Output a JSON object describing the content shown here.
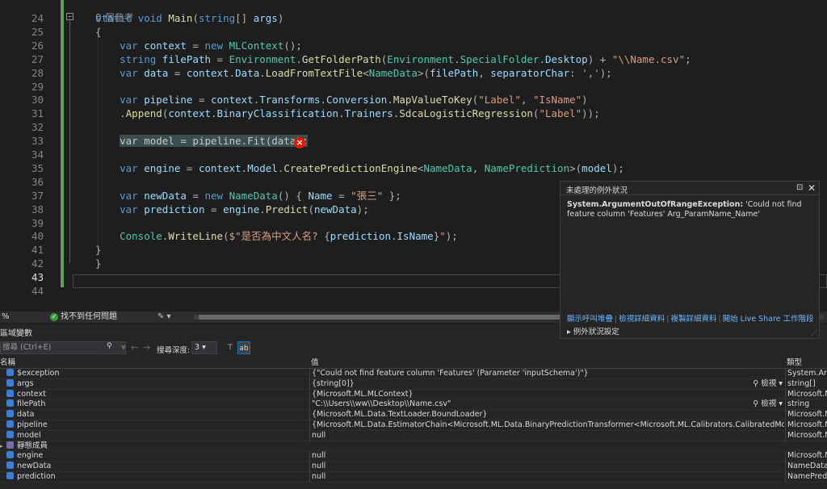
{
  "editor": {
    "ref_hint": "0 個參考",
    "lines": [
      {
        "n": "24",
        "tokens": [
          [
            "kw",
            "static "
          ],
          [
            "kw",
            "void "
          ],
          [
            "fn",
            "Main"
          ],
          [
            "pn",
            "("
          ],
          [
            "kw",
            "string"
          ],
          [
            "pn",
            "[] "
          ],
          [
            "id",
            "args"
          ],
          [
            "pn",
            ")"
          ]
        ]
      },
      {
        "n": "25",
        "tokens": [
          [
            "pn",
            "{"
          ]
        ]
      },
      {
        "n": "26",
        "tokens": [
          [
            "pl",
            "    "
          ],
          [
            "kw",
            "var "
          ],
          [
            "id",
            "context "
          ],
          [
            "pn",
            "= "
          ],
          [
            "kw",
            "new "
          ],
          [
            "ty",
            "MLContext"
          ],
          [
            "pn",
            "();"
          ]
        ]
      },
      {
        "n": "27",
        "tokens": [
          [
            "pl",
            "    "
          ],
          [
            "kw",
            "string "
          ],
          [
            "id",
            "filePath "
          ],
          [
            "pn",
            "= "
          ],
          [
            "ty",
            "Environment"
          ],
          [
            "pn",
            "."
          ],
          [
            "fn",
            "GetFolderPath"
          ],
          [
            "pn",
            "("
          ],
          [
            "ty",
            "Environment"
          ],
          [
            "pn",
            "."
          ],
          [
            "ty",
            "SpecialFolder"
          ],
          [
            "pn",
            "."
          ],
          [
            "id",
            "Desktop"
          ],
          [
            "pn",
            ") + "
          ],
          [
            "st",
            "\"\\\\Name.csv\""
          ],
          [
            "pn",
            ";"
          ]
        ]
      },
      {
        "n": "28",
        "tokens": [
          [
            "pl",
            "    "
          ],
          [
            "kw",
            "var "
          ],
          [
            "id",
            "data "
          ],
          [
            "pn",
            "= "
          ],
          [
            "id",
            "context"
          ],
          [
            "pn",
            "."
          ],
          [
            "id",
            "Data"
          ],
          [
            "pn",
            "."
          ],
          [
            "fn",
            "LoadFromTextFile"
          ],
          [
            "pn",
            "<"
          ],
          [
            "ty",
            "NameData"
          ],
          [
            "pn",
            ">("
          ],
          [
            "id",
            "filePath"
          ],
          [
            "pn",
            ", "
          ],
          [
            "id",
            "separatorChar"
          ],
          [
            "pn",
            ": "
          ],
          [
            "st",
            "','"
          ],
          [
            "pn",
            ");"
          ]
        ]
      },
      {
        "n": "29",
        "tokens": []
      },
      {
        "n": "30",
        "tokens": [
          [
            "pl",
            "    "
          ],
          [
            "kw",
            "var "
          ],
          [
            "id",
            "pipeline "
          ],
          [
            "pn",
            "= "
          ],
          [
            "id",
            "context"
          ],
          [
            "pn",
            "."
          ],
          [
            "id",
            "Transforms"
          ],
          [
            "pn",
            "."
          ],
          [
            "id",
            "Conversion"
          ],
          [
            "pn",
            "."
          ],
          [
            "fn",
            "MapValueToKey"
          ],
          [
            "pn",
            "("
          ],
          [
            "st",
            "\"Label\""
          ],
          [
            "pn",
            ", "
          ],
          [
            "st",
            "\"IsName\""
          ],
          [
            "pn",
            ")"
          ]
        ]
      },
      {
        "n": "31",
        "tokens": [
          [
            "pl",
            "    "
          ],
          [
            "pn",
            "."
          ],
          [
            "fn",
            "Append"
          ],
          [
            "pn",
            "("
          ],
          [
            "id",
            "context"
          ],
          [
            "pn",
            "."
          ],
          [
            "id",
            "BinaryClassification"
          ],
          [
            "pn",
            "."
          ],
          [
            "id",
            "Trainers"
          ],
          [
            "pn",
            "."
          ],
          [
            "fn",
            "SdcaLogisticRegression"
          ],
          [
            "pn",
            "("
          ],
          [
            "st",
            "\"Label\""
          ],
          [
            "pn",
            "));"
          ]
        ]
      },
      {
        "n": "32",
        "tokens": []
      },
      {
        "n": "33",
        "tokens": [
          [
            "pl",
            "    "
          ],
          [
            "sel",
            "var model = pipeline.Fit(data);"
          ]
        ]
      },
      {
        "n": "34",
        "tokens": []
      },
      {
        "n": "35",
        "tokens": [
          [
            "pl",
            "    "
          ],
          [
            "kw",
            "var "
          ],
          [
            "id",
            "engine "
          ],
          [
            "pn",
            "= "
          ],
          [
            "id",
            "context"
          ],
          [
            "pn",
            "."
          ],
          [
            "id",
            "Model"
          ],
          [
            "pn",
            "."
          ],
          [
            "fn",
            "CreatePredictionEngine"
          ],
          [
            "pn",
            "<"
          ],
          [
            "ty",
            "NameData"
          ],
          [
            "pn",
            ", "
          ],
          [
            "ty",
            "NamePrediction"
          ],
          [
            "pn",
            ">("
          ],
          [
            "id",
            "model"
          ],
          [
            "pn",
            ");"
          ]
        ]
      },
      {
        "n": "36",
        "tokens": []
      },
      {
        "n": "37",
        "tokens": [
          [
            "pl",
            "    "
          ],
          [
            "kw",
            "var "
          ],
          [
            "id",
            "newData "
          ],
          [
            "pn",
            "= "
          ],
          [
            "kw",
            "new "
          ],
          [
            "ty",
            "NameData"
          ],
          [
            "pn",
            "() { "
          ],
          [
            "id",
            "Name "
          ],
          [
            "pn",
            "= "
          ],
          [
            "st",
            "\"張三\""
          ],
          [
            "pn",
            " };"
          ]
        ]
      },
      {
        "n": "38",
        "tokens": [
          [
            "pl",
            "    "
          ],
          [
            "kw",
            "var "
          ],
          [
            "id",
            "prediction "
          ],
          [
            "pn",
            "= "
          ],
          [
            "id",
            "engine"
          ],
          [
            "pn",
            "."
          ],
          [
            "fn",
            "Predict"
          ],
          [
            "pn",
            "("
          ],
          [
            "id",
            "newData"
          ],
          [
            "pn",
            ");"
          ]
        ]
      },
      {
        "n": "39",
        "tokens": []
      },
      {
        "n": "40",
        "tokens": [
          [
            "pl",
            "    "
          ],
          [
            "ty",
            "Console"
          ],
          [
            "pn",
            "."
          ],
          [
            "fn",
            "WriteLine"
          ],
          [
            "pn",
            "("
          ],
          [
            "st",
            "$\"是否為中文人名? "
          ],
          [
            "pn",
            "{"
          ],
          [
            "id",
            "prediction"
          ],
          [
            "pn",
            "."
          ],
          [
            "id",
            "IsName"
          ],
          [
            "pn",
            "}"
          ],
          [
            "st",
            "\""
          ],
          [
            "pn",
            ");"
          ]
        ]
      },
      {
        "n": "41",
        "tokens": [
          [
            "pn",
            "}"
          ]
        ]
      },
      {
        "n": "42",
        "tokens": [
          [
            "pn",
            "}"
          ]
        ]
      },
      {
        "n": "43",
        "tokens": []
      },
      {
        "n": "44",
        "tokens": []
      }
    ]
  },
  "status": {
    "zoom": "%",
    "issues": "找不到任何問題"
  },
  "exception": {
    "title": "未處理的例外狀況",
    "type": "System.ArgumentOutOfRangeException:",
    "message": " 'Could not find feature column 'Features' Arg_ParamName_Name'",
    "links": [
      "顯示呼叫堆疊",
      "檢視詳細資料",
      "複製詳細資料",
      "開始 Live Share 工作階段"
    ],
    "settings": "例外狀況設定"
  },
  "locals": {
    "title": "區域變數",
    "search_placeholder": "搜尋 (Ctrl+E)",
    "depth_label": "搜尋深度:",
    "depth_value": "3",
    "headers": {
      "name": "名稱",
      "value": "值",
      "type": "類型"
    },
    "viewer_label": "檢視",
    "rows": [
      {
        "name": "$exception",
        "value": "{\"Could not find feature column 'Features' (Parameter 'inputSchema')\"}",
        "type": "System.ArgumentOutOfRangeException",
        "viewer": false,
        "expander": false
      },
      {
        "name": "args",
        "value": "{string[0]}",
        "type": "string[]",
        "viewer": true,
        "expander": false
      },
      {
        "name": "context",
        "value": "{Microsoft.ML.MLContext}",
        "type": "Microsoft.ML.MLContext",
        "viewer": false,
        "expander": false
      },
      {
        "name": "filePath",
        "value": "\"C:\\\\Users\\\\ww\\\\Desktop\\\\Name.csv\"",
        "type": "string",
        "viewer": true,
        "expander": false
      },
      {
        "name": "data",
        "value": "{Microsoft.ML.Data.TextLoader.BoundLoader}",
        "type": "Microsoft.ML.IDataView",
        "viewer": false,
        "expander": false
      },
      {
        "name": "pipeline",
        "value": "{Microsoft.ML.Data.EstimatorChain<Microsoft.ML.Data.BinaryPredictionTransformer<Microsoft.ML.Calibrators.CalibratedModelParametersBase...",
        "type": "Microsoft.ML.Data.EstimatorChain",
        "viewer": false,
        "expander": false
      },
      {
        "name": "model",
        "value": "null",
        "type": "Microsoft.ML.Data.TransformerChain",
        "viewer": false,
        "expander": false
      },
      {
        "name": "靜態成員",
        "value": "",
        "type": "",
        "viewer": false,
        "expander": true
      },
      {
        "name": "engine",
        "value": "null",
        "type": "Microsoft.ML.PredictionEngine",
        "viewer": false,
        "expander": false
      },
      {
        "name": "newData",
        "value": "null",
        "type": "NameData",
        "viewer": false,
        "expander": false
      },
      {
        "name": "prediction",
        "value": "null",
        "type": "NamePrediction",
        "viewer": false,
        "expander": false
      }
    ]
  }
}
